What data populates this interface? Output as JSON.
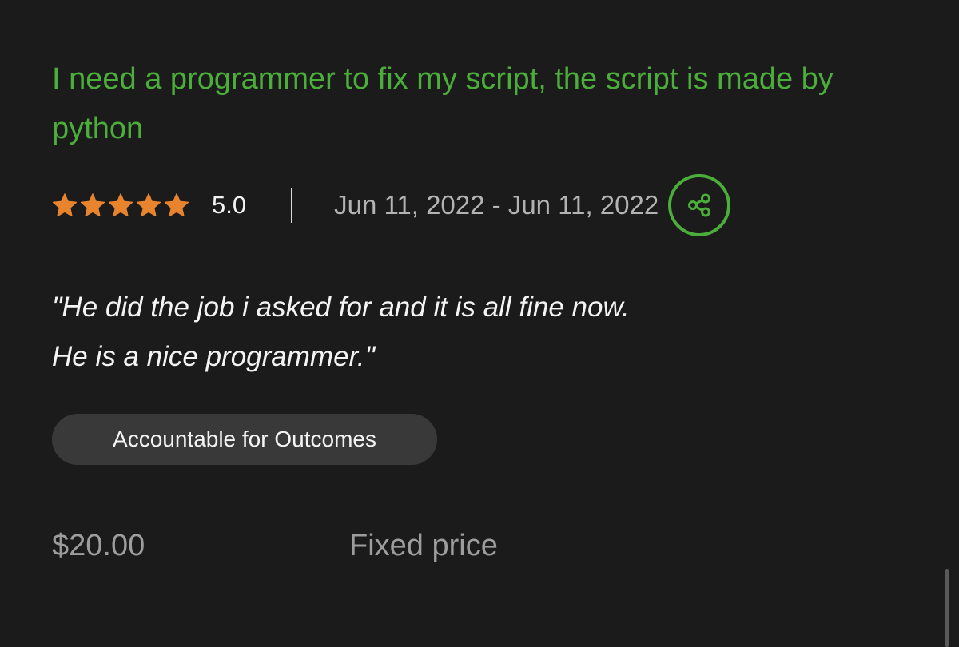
{
  "job": {
    "title": "I need a programmer to fix my script, the script is made by python",
    "rating_value": 5,
    "rating_max": 5,
    "rating_text": "5.0",
    "date_range": "Jun 11, 2022 - Jun 11, 2022",
    "share_icon": "share-icon",
    "review_line1": "\"He did the job i asked for and it is all fine now.",
    "review_line2": "He is a nice programmer.\"",
    "tag": "Accountable for Outcomes",
    "price": "$20.00",
    "price_type": "Fixed price"
  },
  "colors": {
    "background": "#1b1b1b",
    "accent_green": "#4cae3a",
    "star_orange": "#e8832e",
    "muted_text": "#9d9d9d",
    "tag_background": "#393939"
  }
}
